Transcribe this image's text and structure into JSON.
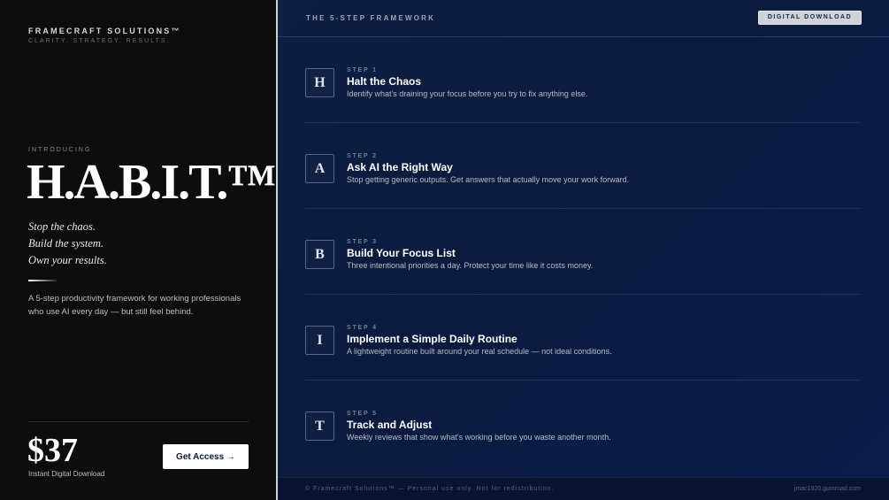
{
  "brand": {
    "name": "FRAMECRAFT SOLUTIONS™",
    "tagline": "CLARITY. STRATEGY. RESULTS."
  },
  "hero": {
    "intro": "INTRODUCING",
    "product_name": "H.A.B.I.T.™",
    "tagline_lines": [
      "Stop the chaos.",
      "Build the system.",
      "Own your results."
    ],
    "description": "A 5-step productivity framework for working professionals who use AI every day — but still feel behind."
  },
  "pricing": {
    "price": "$37",
    "note": "Instant Digital Download",
    "cta_label": "Get Access →"
  },
  "framework": {
    "header_title": "THE 5-STEP FRAMEWORK",
    "badge": "DIGITAL DOWNLOAD",
    "steps": [
      {
        "letter": "H",
        "number": "STEP 1",
        "title": "Halt the Chaos",
        "description": "Identify what's draining your focus before you try to fix anything else."
      },
      {
        "letter": "A",
        "number": "STEP 2",
        "title": "Ask AI the Right Way",
        "description": "Stop getting generic outputs. Get answers that actually move your work forward."
      },
      {
        "letter": "B",
        "number": "STEP 3",
        "title": "Build Your Focus List",
        "description": "Three intentional priorities a day. Protect your time like it costs money."
      },
      {
        "letter": "I",
        "number": "STEP 4",
        "title": "Implement a Simple Daily Routine",
        "description": "A lightweight routine built around your real schedule — not ideal conditions."
      },
      {
        "letter": "T",
        "number": "STEP 5",
        "title": "Track and Adjust",
        "description": "Weekly reviews that show what's working before you waste another month."
      }
    ]
  },
  "footer": {
    "copyright": "© Framecraft Solutions™ — Personal use only. Not for redistribution.",
    "url": "jmac1920.gumroad.com"
  }
}
